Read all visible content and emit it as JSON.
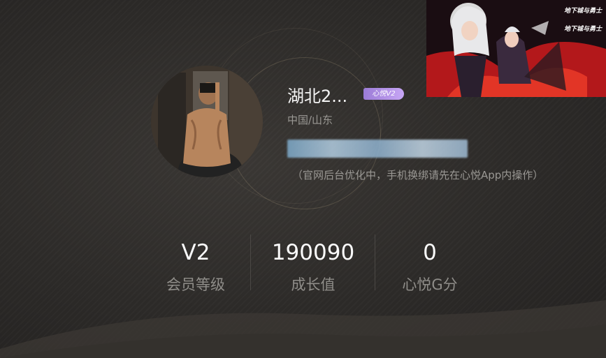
{
  "profile": {
    "nickname": "湖北2...",
    "vip_badge": "心悦V2",
    "region": "中国/山东",
    "phone_masked": "",
    "hint": "（官网后台优化中，手机换绑请先在心悦App内操作）"
  },
  "stats": [
    {
      "value": "V2",
      "label": "会员等级"
    },
    {
      "value": "190090",
      "label": "成长值"
    },
    {
      "value": "0",
      "label": "心悦G分"
    }
  ],
  "promo": {
    "logo_text_1": "地下城与勇士",
    "logo_text_2": "地下城与勇士"
  },
  "colors": {
    "background": "#2c2a28",
    "badge": "#b08fe6",
    "muted_text": "#9a9894"
  }
}
